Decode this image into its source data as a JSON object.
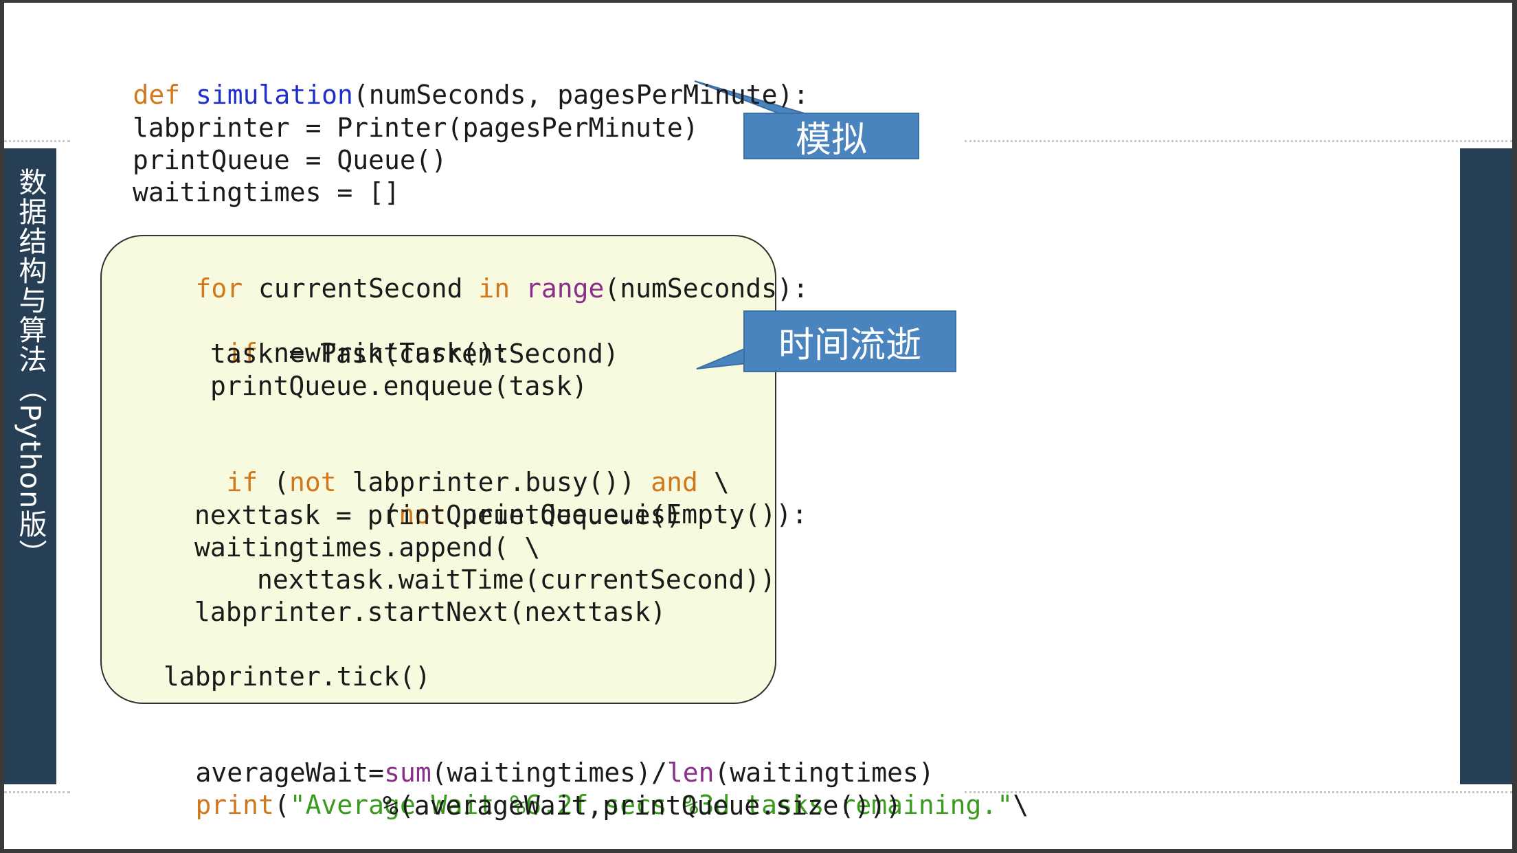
{
  "slide": {
    "side_title": "数据结构与算法（Python版）"
  },
  "callouts": {
    "simulate": "模拟",
    "time_passing": "时间流逝"
  },
  "code": {
    "l1": {
      "a": "def",
      "b": " ",
      "c": "simulation",
      "d": "(numSeconds, pagesPerMinute):"
    },
    "l2": "labprinter = Printer(pagesPerMinute)",
    "l3": "printQueue = Queue()",
    "l4": "waitingtimes = []",
    "l5": {
      "a": "for",
      "b": " currentSecond ",
      "c": "in",
      "d": " ",
      "e": "range",
      "f": "(numSeconds):"
    },
    "l6": {
      "a": "if",
      "b": " newPrintTask():"
    },
    "l7": "task = Task(currentSecond)",
    "l8": "printQueue.enqueue(task)",
    "l9": {
      "a": "if",
      "b": " (",
      "c": "not",
      "d": " labprinter.busy()) ",
      "e": "and",
      "f": " \\"
    },
    "l10": {
      "a": "(",
      "b": "not",
      "c": " printQueue.isEmpty()):"
    },
    "l11": "nexttask = printQueue.dequeue()",
    "l12": "waitingtimes.append( \\",
    "l13": "nexttask.waitTime(currentSecond))",
    "l14": "labprinter.startNext(nexttask)",
    "l15": "labprinter.tick()",
    "l16": {
      "a": "averageWait=",
      "b": "sum",
      "c": "(waitingtimes)/",
      "d": "len",
      "e": "(waitingtimes)"
    },
    "l17": {
      "a": "print",
      "b": "(",
      "c": "\"Average Wait %6.2f secs %3d tasks remaining.\"",
      "d": "\\"
    },
    "l18": "%(averageWait,printQueue.size()))"
  },
  "colors": {
    "keyword": "#d2781c",
    "function_name": "#1e2fd0",
    "builtin": "#8a2f8a",
    "string": "#3a9b1e",
    "sidebar": "#263f55",
    "callout": "#4a84be",
    "loop_box_fill": "#f8fadf"
  }
}
